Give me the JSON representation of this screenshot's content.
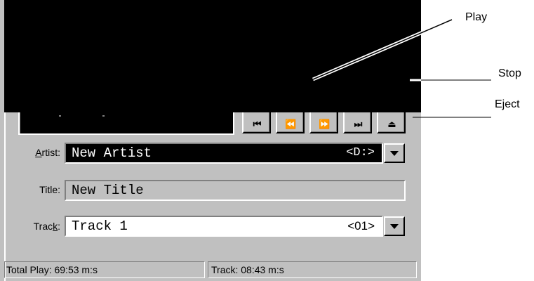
{
  "callouts": {
    "play": "Play",
    "stop": "Stop",
    "eject": "Eject"
  },
  "transport": {
    "buttons": [
      {
        "name": "skip-back",
        "glyph": "⏮"
      },
      {
        "name": "rewind",
        "glyph": "⏪"
      },
      {
        "name": "fast-forward",
        "glyph": "⏩"
      },
      {
        "name": "skip-forward",
        "glyph": "⏭"
      },
      {
        "name": "eject",
        "glyph": "⏏"
      }
    ]
  },
  "form": {
    "artist": {
      "label_pre": "",
      "label_mnemonic": "A",
      "label_post": "rtist:",
      "value": "New Artist",
      "drive": "<D:>"
    },
    "title": {
      "label": "Title:",
      "value": "New Title"
    },
    "track": {
      "label_pre": "Trac",
      "label_mnemonic": "k",
      "label_post": ":",
      "value": "Track 1",
      "number": "<01>"
    }
  },
  "status": {
    "total_play": "Total Play: 69:53 m:s",
    "track": "Track: 08:43 m:s"
  },
  "colors": {
    "display_bg": "#000000",
    "face": "#c0c0c0",
    "selection": "#000000"
  }
}
